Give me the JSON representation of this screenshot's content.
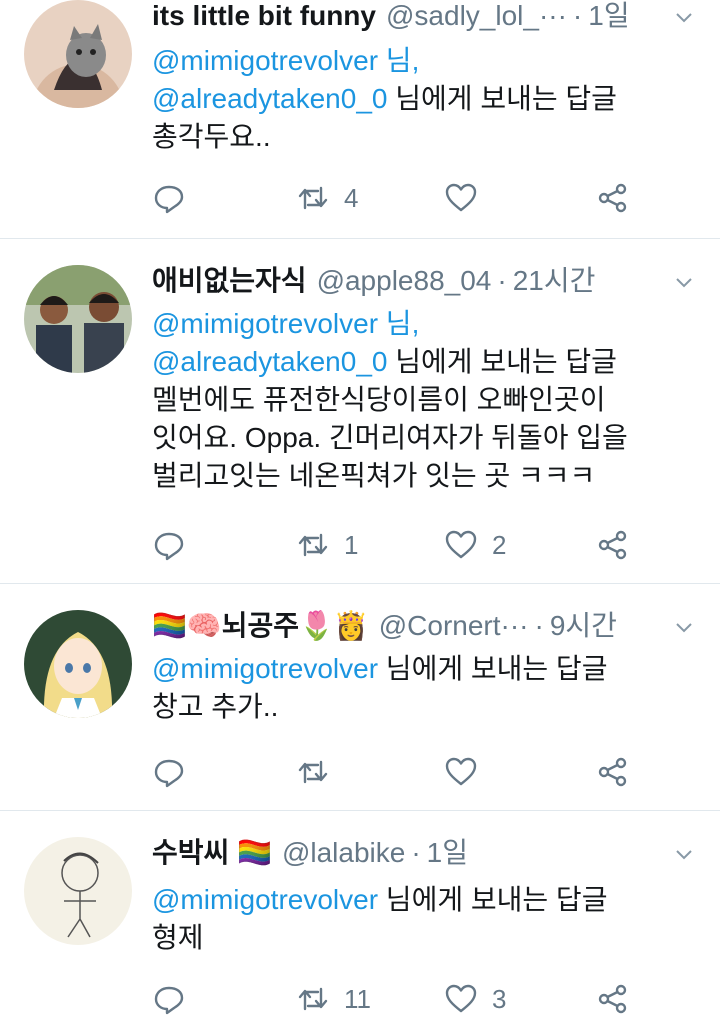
{
  "tweets": [
    {
      "name": "its little bit funny",
      "handle": "@sadly_lol_···",
      "time": "1일",
      "reply_to": [
        "@mimigotrevolver 님,",
        "@alreadytaken0_0 님에게 보내는 답글"
      ],
      "text": [
        "총각두요.."
      ],
      "reply_count": "",
      "retweet_count": "4",
      "like_count": ""
    },
    {
      "name": "애비없는자식",
      "handle": "@apple88_04",
      "time": "21시간",
      "reply_to": [
        "@mimigotrevolver 님,",
        "@alreadytaken0_0 님에게 보내는 답글"
      ],
      "text": [
        "멜번에도 퓨전한식당이름이 오빠인곳이",
        "잇어요. Oppa. 긴머리여자가 뒤돌아 입을",
        "벌리고잇는 네온픽쳐가 잇는 곳 ㅋㅋㅋ"
      ],
      "reply_count": "",
      "retweet_count": "1",
      "like_count": "2"
    },
    {
      "name": "🏳️‍🌈🧠뇌공주🌷👸",
      "handle": "@Cornert···",
      "time": "9시간",
      "reply_to": [
        "@mimigotrevolver 님에게 보내는 답글"
      ],
      "text": [
        "창고 추가.."
      ],
      "reply_count": "",
      "retweet_count": "",
      "like_count": ""
    },
    {
      "name": "수박씨 🏳️‍🌈",
      "handle": "@lalabike",
      "time": "1일",
      "reply_to": [
        "@mimigotrevolver 님에게 보내는 답글"
      ],
      "text": [
        "형제"
      ],
      "reply_count": "",
      "retweet_count": "11",
      "like_count": "3"
    }
  ],
  "colors": {
    "link": "#1b95e0",
    "muted": "#657786",
    "divider": "#e1e8ed"
  },
  "icons": [
    "reply-icon",
    "retweet-icon",
    "like-icon",
    "share-icon",
    "chevron-down-icon"
  ]
}
